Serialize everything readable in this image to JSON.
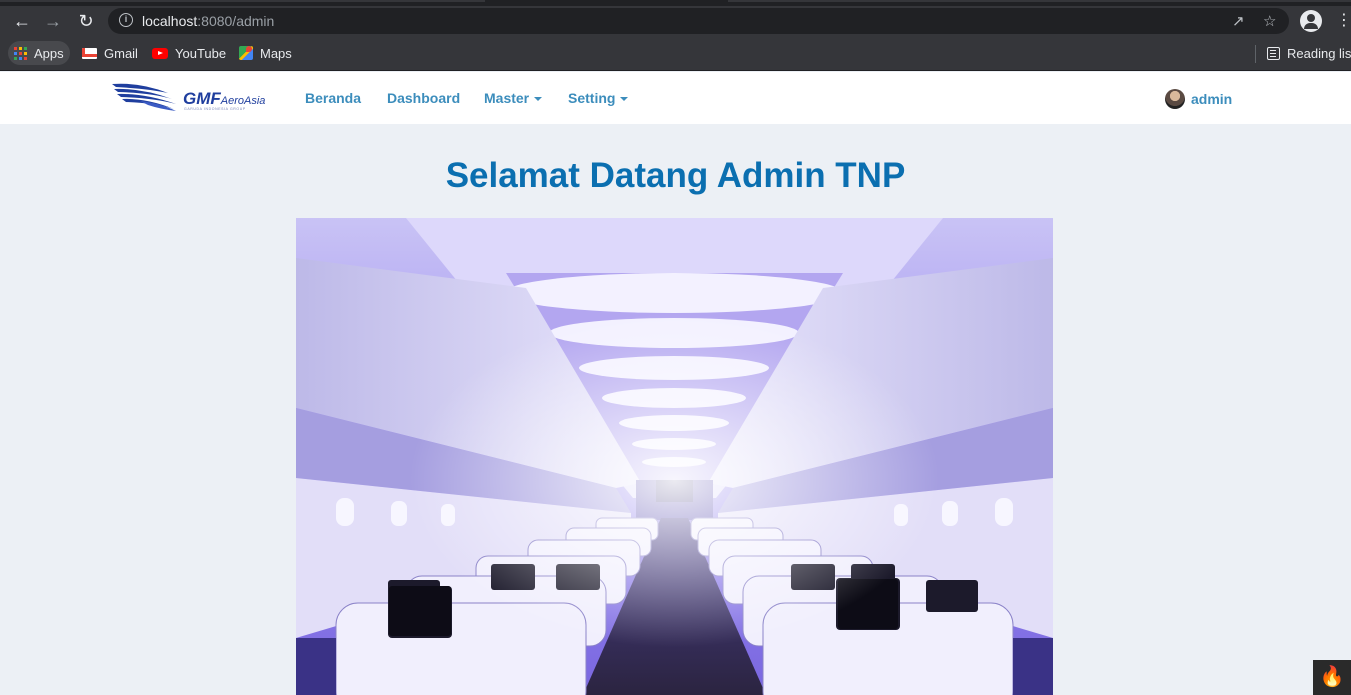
{
  "browser": {
    "url_host": "localhost",
    "url_rest": ":8080/admin",
    "bookmarks": [
      {
        "label": "Apps",
        "icon": "apps-grid-icon"
      },
      {
        "label": "Gmail",
        "icon": "gmail-icon"
      },
      {
        "label": "YouTube",
        "icon": "youtube-icon"
      },
      {
        "label": "Maps",
        "icon": "maps-icon"
      }
    ],
    "reading_list": "Reading list"
  },
  "navbar": {
    "logo_gmf": "GMF",
    "logo_aeroasia": "AeroAsia",
    "logo_sub": "GARUDA INDONESIA GROUP",
    "links": [
      {
        "label": "Beranda",
        "dropdown": false
      },
      {
        "label": "Dashboard",
        "dropdown": false
      },
      {
        "label": "Master",
        "dropdown": true
      },
      {
        "label": "Setting",
        "dropdown": true
      }
    ],
    "user": "admin"
  },
  "content": {
    "welcome_title": "Selamat Datang Admin TNP",
    "hero_image": "aircraft-cabin-interior"
  },
  "colors": {
    "accent": "#3c8dbc",
    "title": "#0b6fb0",
    "page_bg": "#ecf0f5"
  }
}
